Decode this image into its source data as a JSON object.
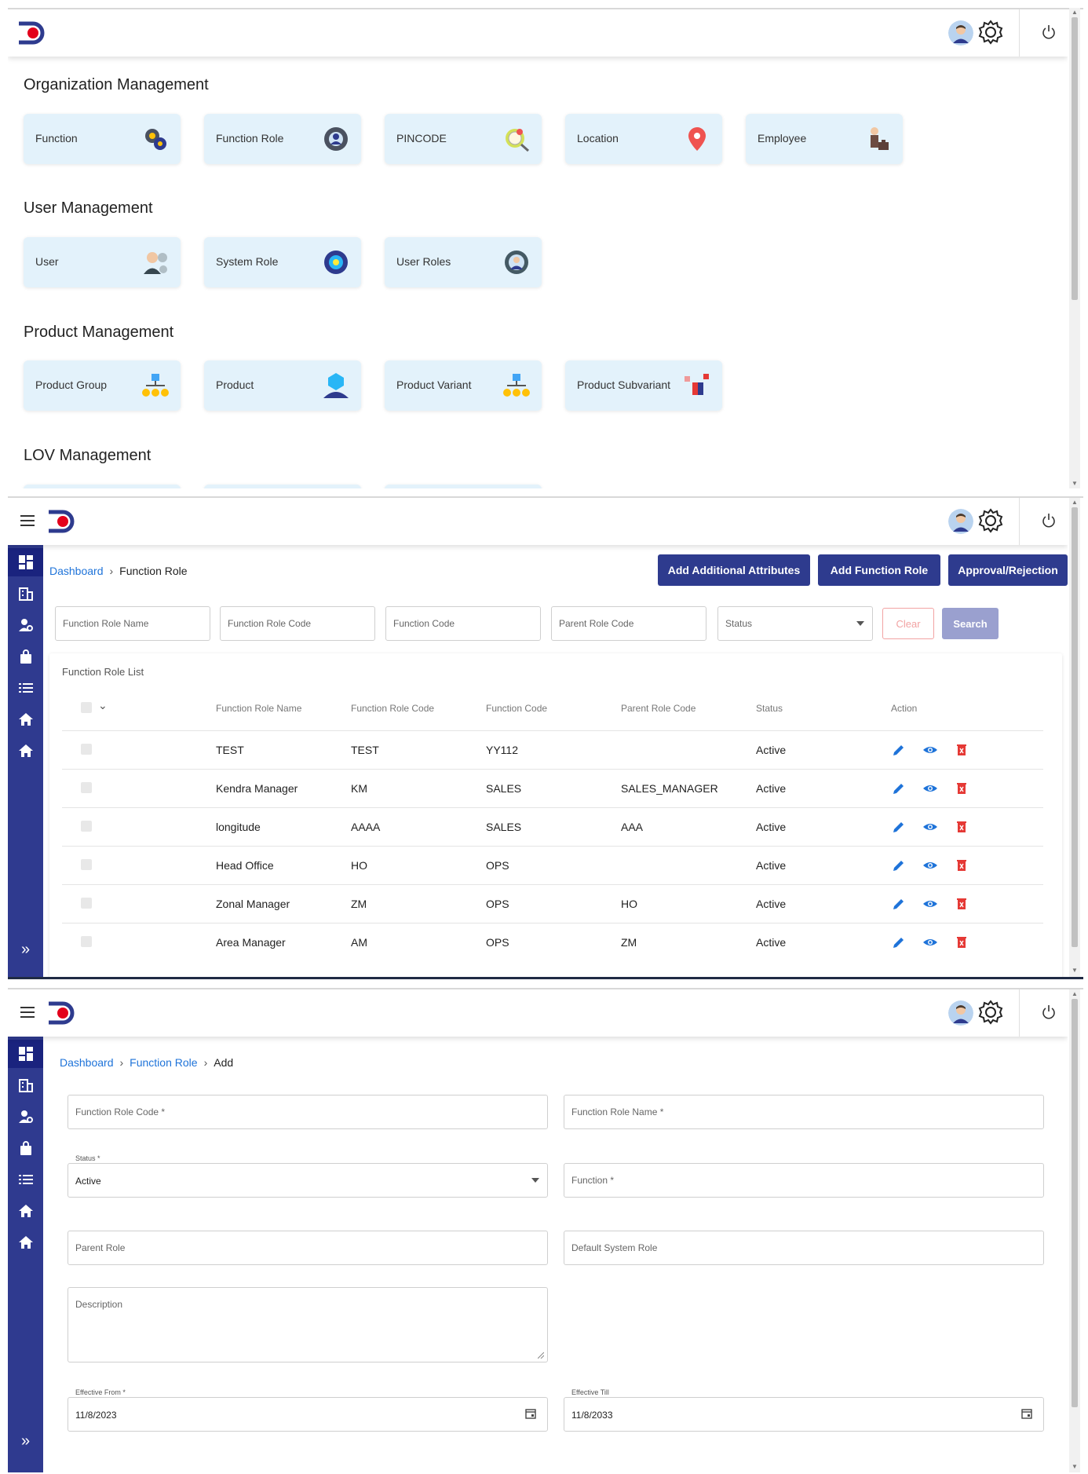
{
  "colors": {
    "brand_navy": "#2e3b8e",
    "sidebar": "#2f3a8f",
    "link": "#1e73d9",
    "tile_bg": "#e3f2fb",
    "logo_red": "#e3001b"
  },
  "icons": [
    "logo",
    "avatar",
    "gear-icon",
    "power-icon",
    "hamburger-icon",
    "dashboard-icon",
    "building-icon",
    "user-gear-icon",
    "bag-icon",
    "list-icon",
    "home-icon",
    "expand-icon",
    "edit-icon",
    "view-icon",
    "delete-icon",
    "calendar-icon"
  ],
  "dashboard": {
    "sections": [
      {
        "title": "Organization Management",
        "tiles": [
          "Function",
          "Function Role",
          "PINCODE",
          "Location",
          "Employee"
        ]
      },
      {
        "title": "User Management",
        "tiles": [
          "User",
          "System Role",
          "User Roles"
        ]
      },
      {
        "title": "Product Management",
        "tiles": [
          "Product Group",
          "Product",
          "Product Variant",
          "Product Subvariant"
        ]
      },
      {
        "title": "LOV Management",
        "tiles": []
      }
    ]
  },
  "list_page": {
    "breadcrumb": {
      "home": "Dashboard",
      "current": "Function Role"
    },
    "buttons": {
      "add_attributes": "Add Additional Attributes",
      "add_role": "Add Function Role",
      "approval": "Approval/Rejection"
    },
    "filters": {
      "role_name": "Function Role Name",
      "role_code": "Function Role Code",
      "function_code": "Function Code",
      "parent_code": "Parent Role Code",
      "status": "Status",
      "clear": "Clear",
      "search": "Search"
    },
    "table": {
      "title": "Function Role List",
      "headers": [
        "Function Role Name",
        "Function Role Code",
        "Function Code",
        "Parent Role Code",
        "Status",
        "Action"
      ],
      "rows": [
        [
          "TEST",
          "TEST",
          "YY112",
          "",
          "Active"
        ],
        [
          "Kendra Manager",
          "KM",
          "SALES",
          "SALES_MANAGER",
          "Active"
        ],
        [
          "longitude",
          "AAAA",
          "SALES",
          "AAA",
          "Active"
        ],
        [
          "Head Office",
          "HO",
          "OPS",
          "",
          "Active"
        ],
        [
          "Zonal Manager",
          "ZM",
          "OPS",
          "HO",
          "Active"
        ],
        [
          "Area Manager",
          "AM",
          "OPS",
          "ZM",
          "Active"
        ]
      ]
    }
  },
  "add_page": {
    "breadcrumb": {
      "home": "Dashboard",
      "parent": "Function Role",
      "current": "Add"
    },
    "fields": {
      "role_code": "Function Role Code *",
      "role_name": "Function Role Name *",
      "status_label": "Status *",
      "status_value": "Active",
      "function": "Function *",
      "parent_role": "Parent Role",
      "default_system_role": "Default System Role",
      "description": "Description",
      "effective_from_label": "Effective From *",
      "effective_from_value": "11/8/2023",
      "effective_till_label": "Effective Till",
      "effective_till_value": "11/8/2033"
    }
  }
}
